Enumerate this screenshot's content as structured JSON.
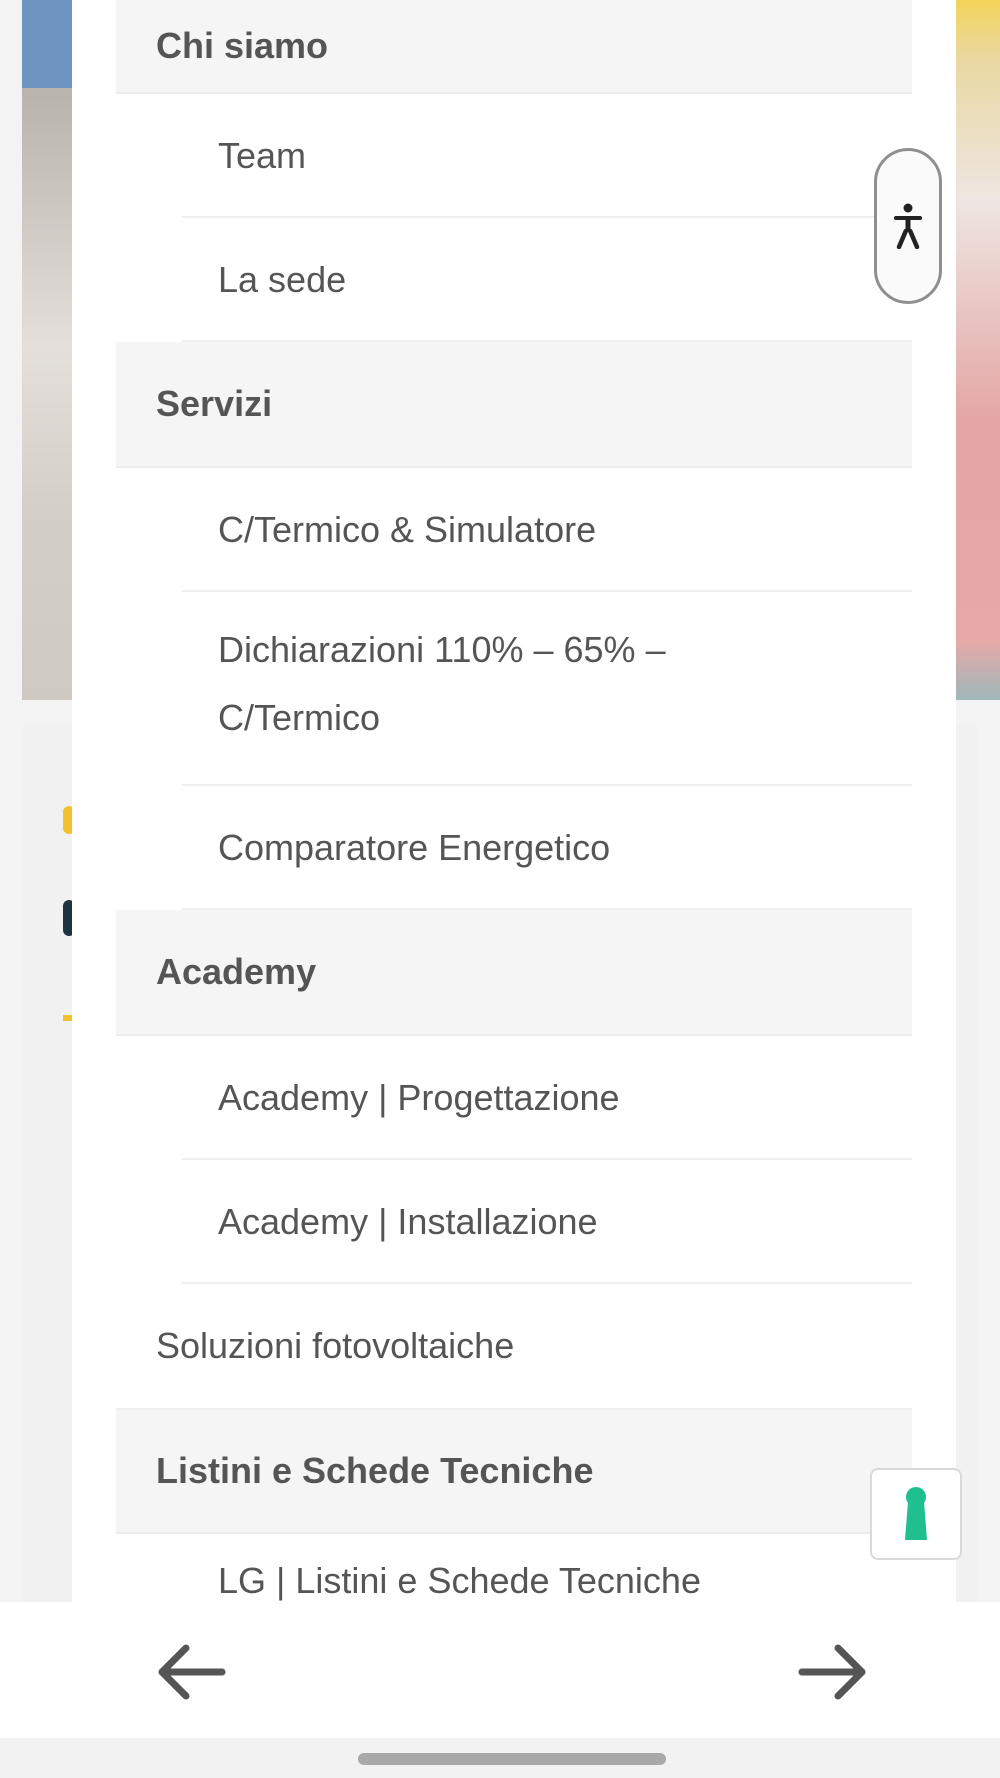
{
  "menu": {
    "items": [
      {
        "label": "Chi siamo",
        "kind": "section"
      },
      {
        "label": "Team",
        "kind": "sub"
      },
      {
        "label": "La sede",
        "kind": "sub"
      },
      {
        "label": "Servizi",
        "kind": "section"
      },
      {
        "label": "C/Termico & Simulatore",
        "kind": "sub"
      },
      {
        "label": "Dichiarazioni 110% – 65% – C/Termico",
        "kind": "sub"
      },
      {
        "label": "Comparatore Energetico",
        "kind": "sub"
      },
      {
        "label": "Academy",
        "kind": "section"
      },
      {
        "label": "Academy | Progettazione",
        "kind": "sub"
      },
      {
        "label": "Academy | Installazione",
        "kind": "sub"
      },
      {
        "label": "Soluzioni fotovoltaiche",
        "kind": "plain"
      },
      {
        "label": "Listini e Schede Tecniche",
        "kind": "section"
      },
      {
        "label": "LG | Listini e Schede Tecniche",
        "kind": "sub"
      }
    ]
  },
  "widgets": {
    "accessibility_icon": "accessibility-person-icon",
    "keyhole_icon": "keyhole-icon",
    "keyhole_color": "#1fbf8f"
  },
  "browser": {
    "back_icon": "arrow-left-icon",
    "forward_icon": "arrow-right-icon"
  }
}
